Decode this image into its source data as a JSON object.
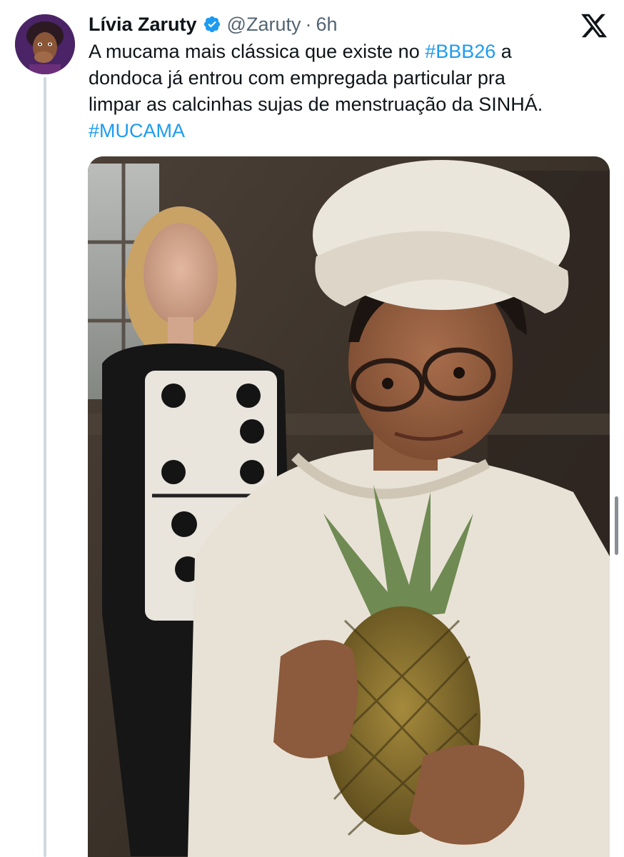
{
  "author": {
    "display_name": "Lívia Zaruty",
    "handle": "@Zaruty",
    "separator": "·",
    "time": "6h",
    "avatar_icon": "avatar-photo",
    "verified_icon": "verified-badge-icon",
    "verified_color": "#1d9bf0"
  },
  "tweet": {
    "lines": [
      [
        {
          "text": "A mucama mais clássica que existe no ",
          "type": "text"
        },
        {
          "text": "#BBB26",
          "type": "hashtag"
        },
        {
          "text": " a",
          "type": "text"
        }
      ],
      [
        {
          "text": "dondoca já entrou com empregada particular pra",
          "type": "text"
        }
      ],
      [
        {
          "text": "limpar as calcinhas sujas de menstruação da SINHÁ.",
          "type": "text"
        }
      ],
      [
        {
          "text": "#MUCAMA",
          "type": "hashtag"
        }
      ]
    ]
  },
  "platform": {
    "logo_icon": "x-logo-icon"
  },
  "colors": {
    "text": "#0f1419",
    "secondary": "#536471",
    "link": "#1d9bf0",
    "thread_line": "#cfd9de"
  }
}
